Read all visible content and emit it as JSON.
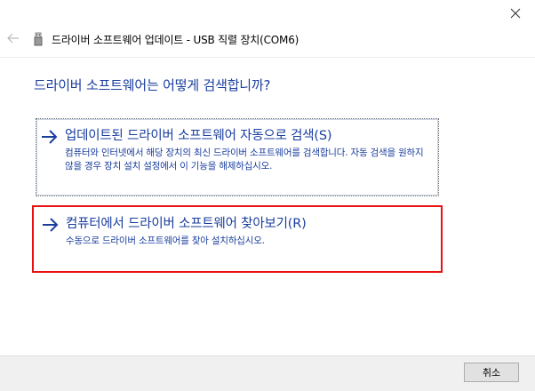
{
  "window": {
    "title": "드라이버 소프트웨어 업데이트 - USB 직렬 장치(COM6)"
  },
  "icons": {
    "close": "close-icon",
    "back": "back-arrow-icon",
    "device": "usb-device-icon",
    "option_arrow": "right-arrow-icon"
  },
  "main": {
    "heading": "드라이버 소프트웨어는 어떻게 검색합니까?",
    "options": [
      {
        "title": "업데이트된 드라이버 소프트웨어 자동으로 검색(S)",
        "description": "컴퓨터와 인터넷에서 해당 장치의 최신 드라이버 소프트웨어를 검색합니다. 자동 검색을 원하지 않을 경우 장치 설치 설정에서 이 기능을 해제하십시오."
      },
      {
        "title": "컴퓨터에서 드라이버 소프트웨어 찾아보기(R)",
        "description": "수동으로 드라이버 소프트웨어를 찾아 설치하십시오."
      }
    ]
  },
  "footer": {
    "cancel_label": "취소"
  },
  "colors": {
    "link_blue": "#1a3e9e",
    "highlight_red": "#e81010",
    "footer_bg": "#f0f0f0"
  }
}
